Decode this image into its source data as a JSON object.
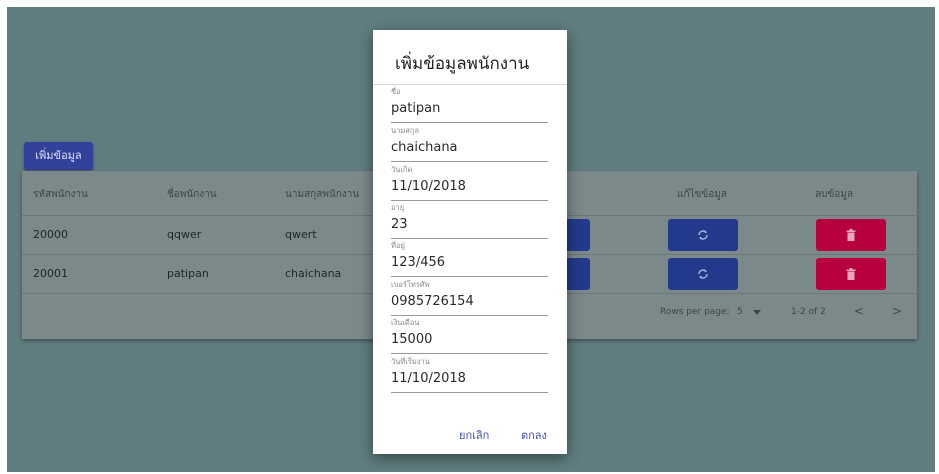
{
  "toolbar": {
    "add_label": "เพิ่มข้อมูล"
  },
  "table": {
    "headers": [
      "รหัสพนักงาน",
      "ชื่อพนักงาน",
      "นามสกุลพนักงาน",
      "แก้ไขข้อมูล",
      "ลบข้อมูล"
    ],
    "rows": [
      [
        "20000",
        "qqwer",
        "qwert"
      ],
      [
        "20001",
        "patipan",
        "chaichana"
      ]
    ],
    "footer": {
      "rows_per_page_label": "Rows per page:",
      "rows_per_page_value": "5",
      "range_text": "1-2 of 2",
      "prev": "<",
      "next": ">"
    }
  },
  "colors": {
    "primary": "#33419a",
    "danger": "#b8003f",
    "backdrop": "#607d80"
  },
  "icons": {
    "edit": "refresh-icon",
    "delete": "trash-icon"
  },
  "dialog": {
    "title": "เพิ่มข้อมูลพนักงาน",
    "fields": [
      {
        "label": "ชื่อ",
        "value": "patipan"
      },
      {
        "label": "นามสกุล",
        "value": "chaichana"
      },
      {
        "label": "วันเกิด",
        "value": "11/10/2018"
      },
      {
        "label": "อายุ",
        "value": "23"
      },
      {
        "label": "ที่อยู่",
        "value": "123/456"
      },
      {
        "label": "เบอร์โทรศัพ",
        "value": "0985726154"
      },
      {
        "label": "เงินเดือน",
        "value": "15000"
      },
      {
        "label": "วันที่เริ่มงาน",
        "value": "11/10/2018"
      }
    ],
    "cancel_label": "ยกเลิก",
    "ok_label": "ตกลง"
  }
}
